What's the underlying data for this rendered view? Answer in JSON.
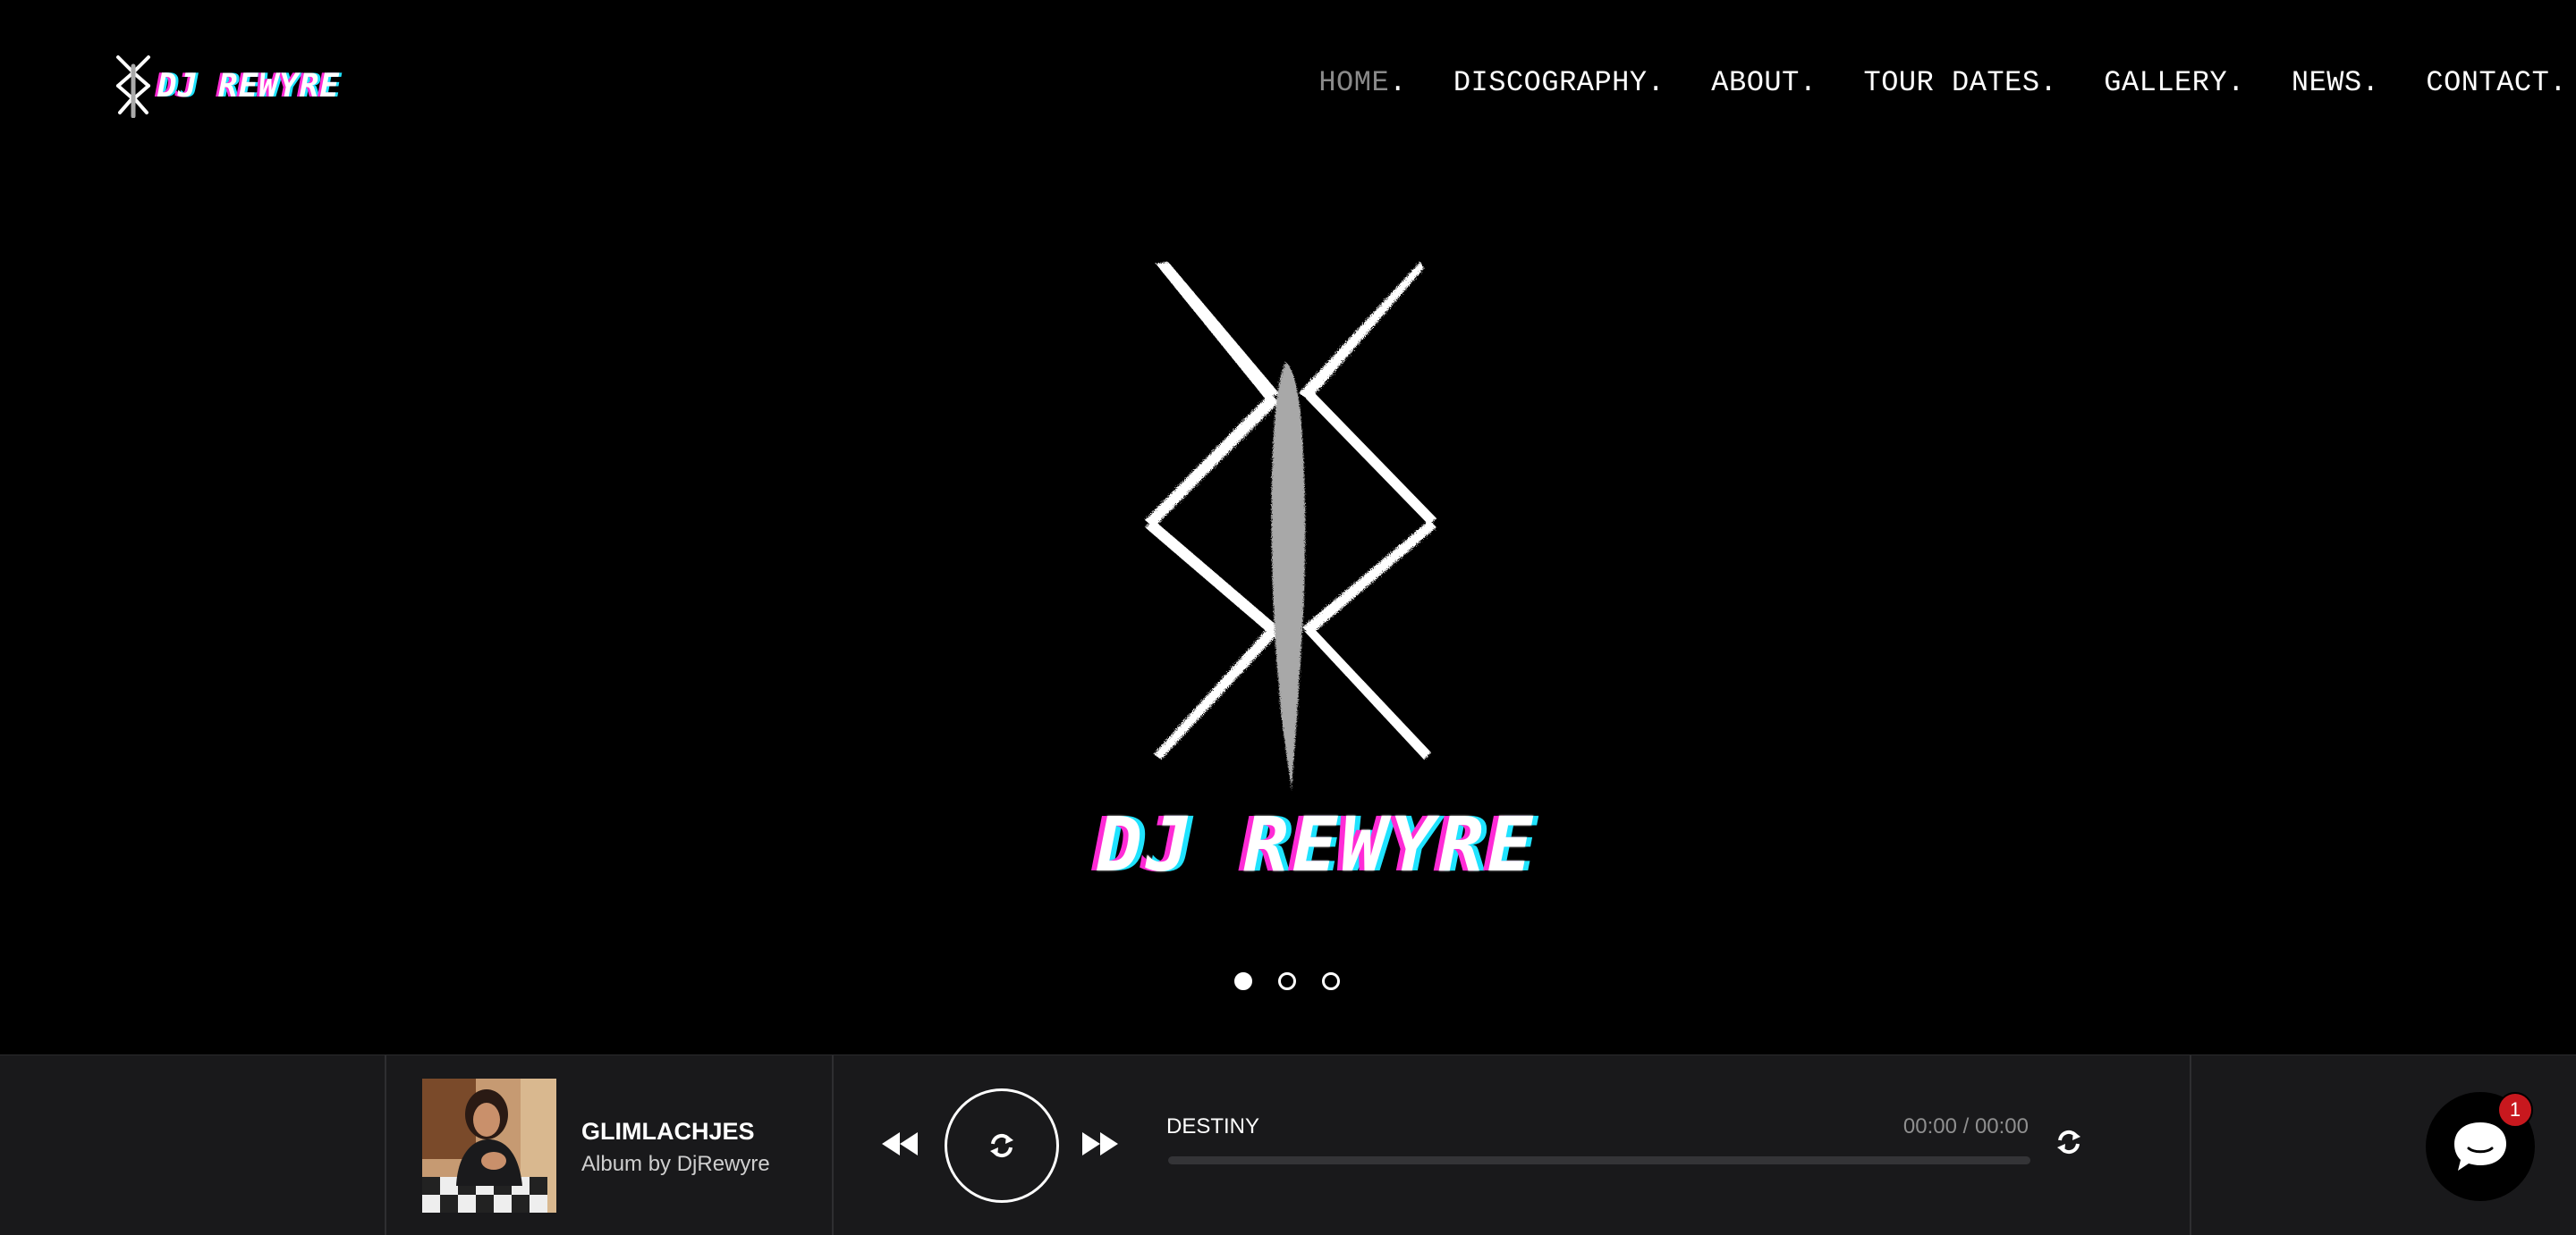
{
  "brand": {
    "logo_text": "DJ REWYRE",
    "colors": {
      "magenta": "#ff2bd6",
      "cyan": "#1fe3ff",
      "inactive_nav": "#8a8a8a"
    }
  },
  "nav": {
    "items": [
      {
        "label": "HOME",
        "active": true
      },
      {
        "label": "DISCOGRAPHY",
        "active": false
      },
      {
        "label": "ABOUT",
        "active": false
      },
      {
        "label": "TOUR DATES",
        "active": false
      },
      {
        "label": "GALLERY",
        "active": false
      },
      {
        "label": "NEWS",
        "active": false
      },
      {
        "label": "CONTACT",
        "active": false
      }
    ],
    "separator": "."
  },
  "hero": {
    "title": "DJ REWYRE",
    "slide_count": 3,
    "active_slide": 1
  },
  "player": {
    "album": {
      "title": "GLIMLACHJES",
      "subtitle": "Album by DjRewyre"
    },
    "track": {
      "name": "DESTINY",
      "time": "00:00 / 00:00",
      "progress": 0
    },
    "icons": [
      "rewind-icon",
      "repeat-icon",
      "fast-forward-icon",
      "repeat-icon"
    ]
  },
  "chat": {
    "badge_count": "1"
  }
}
